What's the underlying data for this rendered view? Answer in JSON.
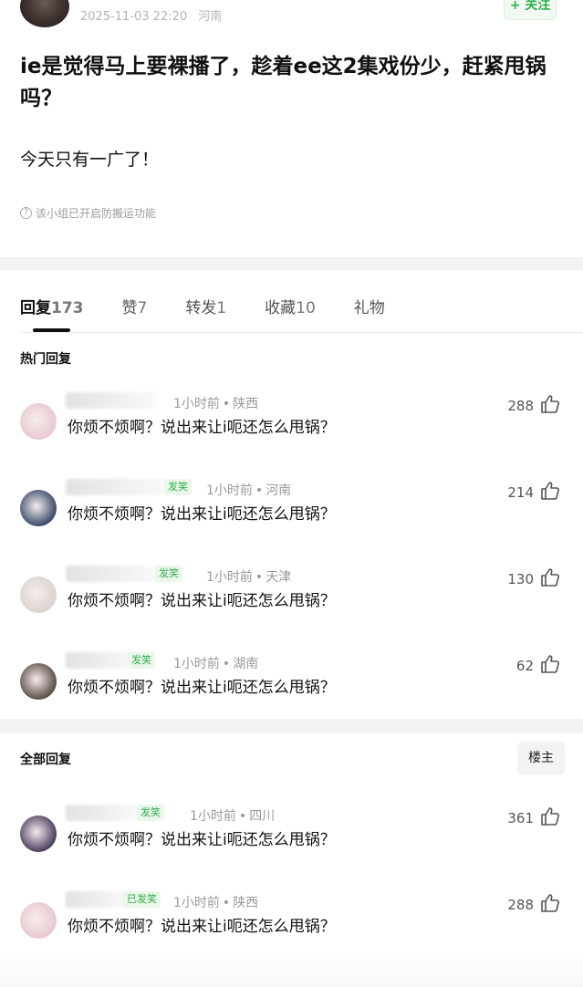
{
  "post": {
    "date": "2025-11-03 22:20",
    "location": "河南",
    "follow_label": "+ 关注",
    "title": "ie是觉得马上要裸播了，趁着ee这2集戏份少，赶紧甩锅吗？",
    "body": "今天只有一广了！",
    "notice": "该小组已开启防搬运功能"
  },
  "tabs": [
    {
      "label": "回复",
      "count": "173"
    },
    {
      "label": "赞",
      "count": "7"
    },
    {
      "label": "转发",
      "count": "1"
    },
    {
      "label": "收藏",
      "count": "10"
    },
    {
      "label": "礼物",
      "count": ""
    }
  ],
  "hot_section_title": "热门回复",
  "all_section_title": "全部回复",
  "owner_filter_label": "楼主",
  "hot_replies": [
    {
      "time": "1小时前",
      "location": "陕西",
      "badge": "",
      "text": "你烦不烦啊？说出来让i呃还怎么甩锅？",
      "likes": "288",
      "avatar_color": "#e8c9cf"
    },
    {
      "time": "1小时前",
      "location": "河南",
      "badge": "发笑",
      "text": "你烦不烦啊？说出来让i呃还怎么甩锅？",
      "likes": "214",
      "avatar_color": "#3b4a6b"
    },
    {
      "time": "1小时前",
      "location": "天津",
      "badge": "发笑",
      "text": "你烦不烦啊？说出来让i呃还怎么甩锅？",
      "likes": "130",
      "avatar_color": "#d9d4cf"
    },
    {
      "time": "1小时前",
      "location": "湖南",
      "badge": "发笑",
      "text": "你烦不烦啊？说出来让i呃还怎么甩锅？",
      "likes": "62",
      "avatar_color": "#5a4e47"
    }
  ],
  "all_replies": [
    {
      "time": "1小时前",
      "location": "四川",
      "badge": "发笑",
      "text": "你烦不烦啊？说出来让i呃还怎么甩锅？",
      "likes": "361",
      "avatar_color": "#4a3f5e"
    },
    {
      "time": "1小时前",
      "location": "陕西",
      "badge": "已发笑",
      "text": "你烦不烦啊？说出来让i呃还怎么甩锅？",
      "likes": "288",
      "avatar_color": "#e8c9cf"
    }
  ],
  "colors": {
    "accent": "#2eae4a",
    "muted": "#9a9a9a",
    "separator": "#f4f2f2"
  }
}
